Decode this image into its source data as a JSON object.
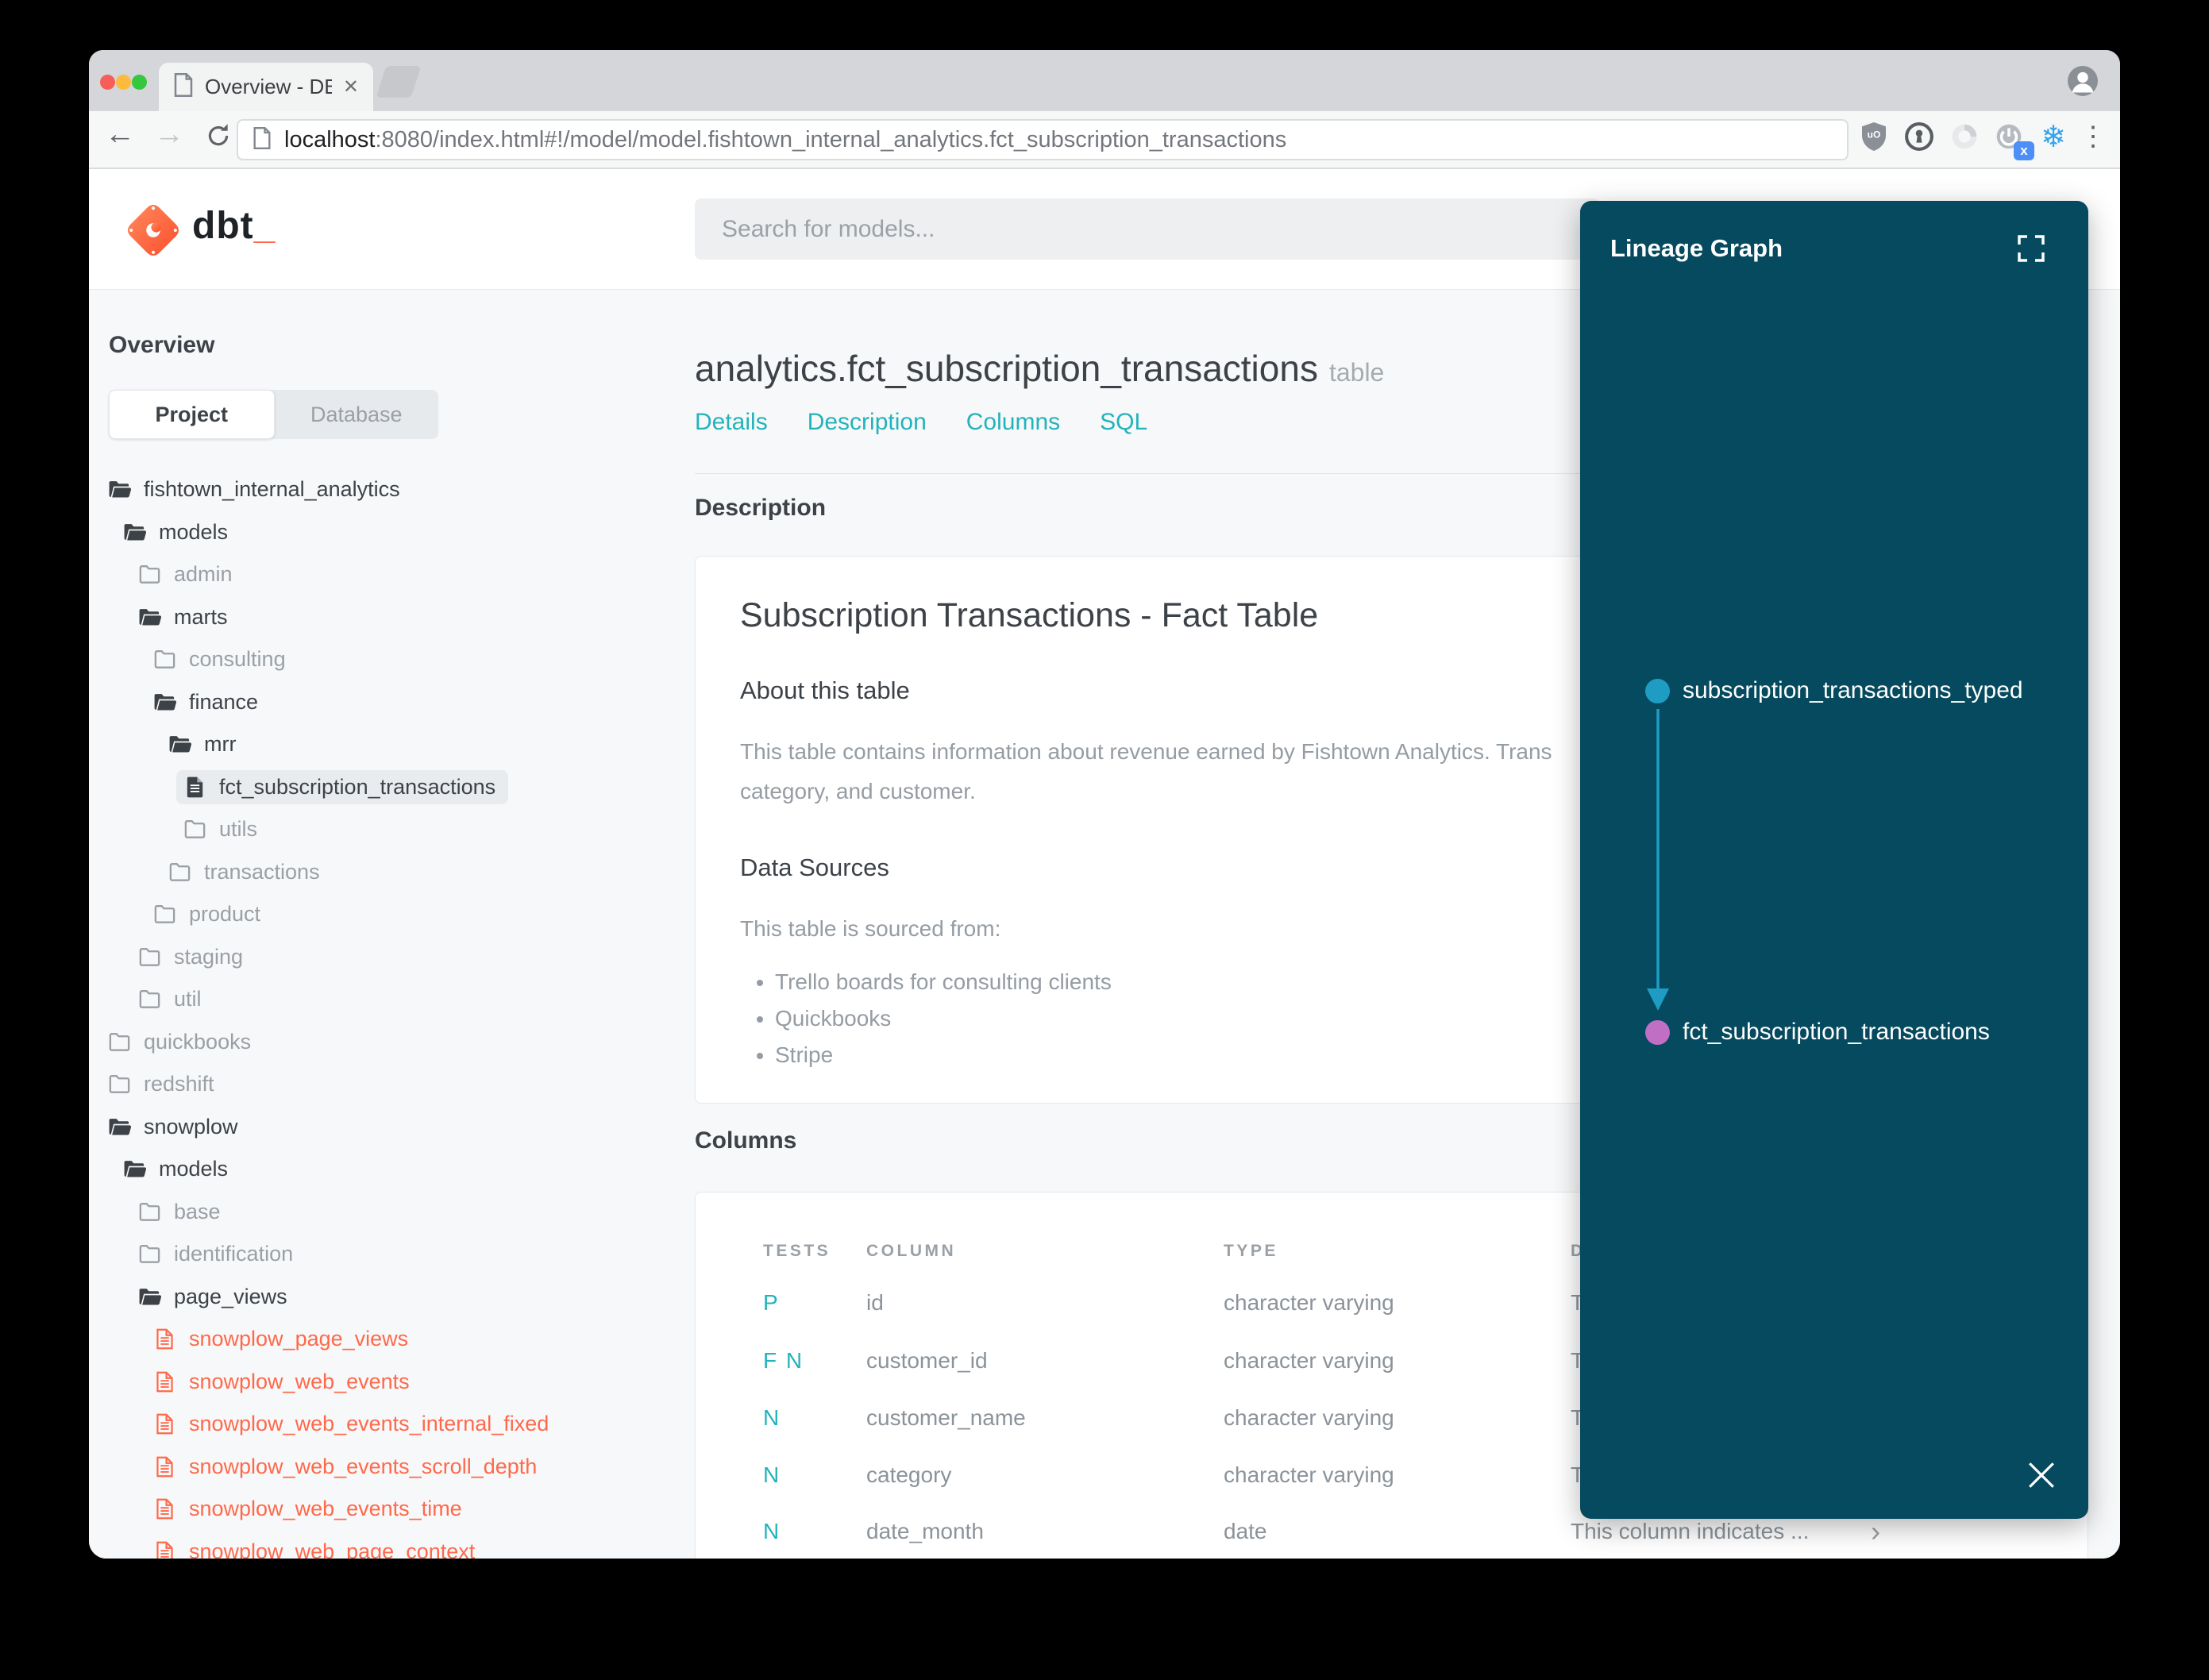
{
  "browser": {
    "tab_title": "Overview - DBT Docs",
    "close_tab_glyph": "✕",
    "back_glyph": "←",
    "forward_glyph": "→",
    "menu_glyph": "⋮",
    "snowflake_glyph": "❄",
    "url": {
      "host": "localhost",
      "rest": ":8080/index.html#!/model/model.fishtown_internal_analytics.fct_subscription_transactions"
    }
  },
  "header": {
    "logo_text": "dbt",
    "logo_cursor": "_",
    "search_placeholder": "Search for models..."
  },
  "sidebar": {
    "overview_label": "Overview",
    "source_tabs": [
      {
        "label": "Project",
        "active": true
      },
      {
        "label": "Database",
        "active": false
      }
    ],
    "tree": [
      {
        "label": "fishtown_internal_analytics",
        "icon": "folder-open",
        "level": 0
      },
      {
        "label": "models",
        "icon": "folder-open",
        "level": 1
      },
      {
        "label": "admin",
        "icon": "folder",
        "level": 2
      },
      {
        "label": "marts",
        "icon": "folder-open",
        "level": 2
      },
      {
        "label": "consulting",
        "icon": "folder",
        "level": 3
      },
      {
        "label": "finance",
        "icon": "folder-open",
        "level": 3
      },
      {
        "label": "mrr",
        "icon": "folder-open",
        "level": 4
      },
      {
        "label": "fct_subscription_transactions",
        "icon": "file",
        "level": 5,
        "selected": true
      },
      {
        "label": "utils",
        "icon": "folder",
        "level": 5
      },
      {
        "label": "transactions",
        "icon": "folder",
        "level": 4
      },
      {
        "label": "product",
        "icon": "folder",
        "level": 3
      },
      {
        "label": "staging",
        "icon": "folder",
        "level": 2
      },
      {
        "label": "util",
        "icon": "folder",
        "level": 2
      },
      {
        "label": "quickbooks",
        "icon": "folder",
        "level": 0
      },
      {
        "label": "redshift",
        "icon": "folder",
        "level": 0
      },
      {
        "label": "snowplow",
        "icon": "folder-open",
        "level": 0
      },
      {
        "label": "models",
        "icon": "folder-open",
        "level": 1
      },
      {
        "label": "base",
        "icon": "folder",
        "level": 2
      },
      {
        "label": "identification",
        "icon": "folder",
        "level": 2
      },
      {
        "label": "page_views",
        "icon": "folder-open",
        "level": 2
      },
      {
        "label": "snowplow_page_views",
        "icon": "file-accent",
        "level": 3
      },
      {
        "label": "snowplow_web_events",
        "icon": "file-accent",
        "level": 3
      },
      {
        "label": "snowplow_web_events_internal_fixed",
        "icon": "file-accent",
        "level": 3
      },
      {
        "label": "snowplow_web_events_scroll_depth",
        "icon": "file-accent",
        "level": 3
      },
      {
        "label": "snowplow_web_events_time",
        "icon": "file-accent",
        "level": 3
      },
      {
        "label": "snowplow_web_page_context",
        "icon": "file-accent",
        "level": 3
      }
    ]
  },
  "main": {
    "title": "analytics.fct_subscription_transactions",
    "badge": "table",
    "nav": [
      "Details",
      "Description",
      "Columns",
      "SQL"
    ],
    "description_label": "Description",
    "doc": {
      "title": "Subscription Transactions - Fact Table",
      "about_heading": "About this table",
      "about_text": "This table contains information about revenue earned by Fishtown Analytics. Trans\ncategory, and customer.",
      "sources_heading": "Data Sources",
      "sources_intro": "This table is sourced from:",
      "sources": [
        "Trello boards for consulting clients",
        "Quickbooks",
        "Stripe"
      ]
    },
    "columns_label": "Columns",
    "table": {
      "headers": [
        "TESTS",
        "COLUMN",
        "TYPE",
        "DESCRIPTION"
      ],
      "rows": [
        {
          "tests": "P",
          "column": "id",
          "type": "character varying",
          "description": "T",
          "chevron": "›"
        },
        {
          "tests": "F N",
          "column": "customer_id",
          "type": "character varying",
          "description": "T",
          "chevron": "›"
        },
        {
          "tests": "N",
          "column": "customer_name",
          "type": "character varying",
          "description": "T",
          "chevron": "›"
        },
        {
          "tests": "N",
          "column": "category",
          "type": "character varying",
          "description": "T",
          "chevron": "›"
        },
        {
          "tests": "N",
          "column": "date_month",
          "type": "date",
          "description": "This column indicates ...",
          "chevron": "›"
        }
      ]
    }
  },
  "lineage": {
    "title": "Lineage Graph",
    "nodes": [
      {
        "label": "subscription_transactions_typed",
        "color": "#1e9cc4"
      },
      {
        "label": "fct_subscription_transactions",
        "color": "#c06fc4"
      }
    ],
    "edge_color": "#1e9cc4"
  },
  "colors": {
    "accent_orange": "#ff694b",
    "teal_link": "#23b3bb",
    "panel_bg": "#054a5e"
  }
}
